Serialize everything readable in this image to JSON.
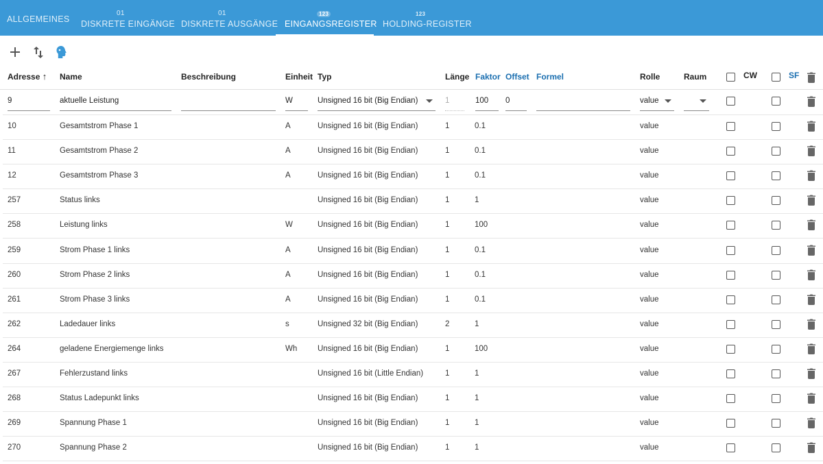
{
  "tabs": [
    {
      "label": "ALLGEMEINES",
      "icon_text": ""
    },
    {
      "label": "DISKRETE EINGÄNGE",
      "icon_text": "01"
    },
    {
      "label": "DISKRETE AUSGÄNGE",
      "icon_text": "01"
    },
    {
      "label": "EINGANGSREGISTER",
      "icon_text": "123",
      "active": true
    },
    {
      "label": "HOLDING-REGISTER",
      "icon_text": "123"
    }
  ],
  "toolbar": {
    "add_icon": "plus-icon",
    "sort_icon": "swap-vertical-icon",
    "import_icon": "head-icon"
  },
  "columns": {
    "address": "Adresse",
    "name": "Name",
    "description": "Beschreibung",
    "unit": "Einheit",
    "type": "Typ",
    "length": "Länge",
    "factor": "Faktor",
    "offset": "Offset",
    "formula": "Formel",
    "role": "Rolle",
    "room": "Raum",
    "cw": "CW",
    "sf": "SF"
  },
  "edit_row": {
    "address": "9",
    "name": "aktuelle Leistung",
    "description": "",
    "unit": "W",
    "type": "Unsigned 16 bit (Big Endian)",
    "length": "1",
    "factor": "100",
    "offset": "0",
    "formula": "",
    "role": "value",
    "room": ""
  },
  "rows": [
    {
      "address": "10",
      "name": "Gesamtstrom Phase 1",
      "unit": "A",
      "type": "Unsigned 16 bit (Big Endian)",
      "length": "1",
      "factor": "0.1",
      "role": "value"
    },
    {
      "address": "11",
      "name": "Gesamtstrom Phase 2",
      "unit": "A",
      "type": "Unsigned 16 bit (Big Endian)",
      "length": "1",
      "factor": "0.1",
      "role": "value"
    },
    {
      "address": "12",
      "name": "Gesamtstrom Phase 3",
      "unit": "A",
      "type": "Unsigned 16 bit (Big Endian)",
      "length": "1",
      "factor": "0.1",
      "role": "value"
    },
    {
      "address": "257",
      "name": "Status links",
      "unit": "",
      "type": "Unsigned 16 bit (Big Endian)",
      "length": "1",
      "factor": "1",
      "role": "value"
    },
    {
      "address": "258",
      "name": "Leistung links",
      "unit": "W",
      "type": "Unsigned 16 bit (Big Endian)",
      "length": "1",
      "factor": "100",
      "role": "value"
    },
    {
      "address": "259",
      "name": "Strom Phase 1 links",
      "unit": "A",
      "type": "Unsigned 16 bit (Big Endian)",
      "length": "1",
      "factor": "0.1",
      "role": "value"
    },
    {
      "address": "260",
      "name": "Strom Phase 2 links",
      "unit": "A",
      "type": "Unsigned 16 bit (Big Endian)",
      "length": "1",
      "factor": "0.1",
      "role": "value"
    },
    {
      "address": "261",
      "name": "Strom Phase 3 links",
      "unit": "A",
      "type": "Unsigned 16 bit (Big Endian)",
      "length": "1",
      "factor": "0.1",
      "role": "value"
    },
    {
      "address": "262",
      "name": "Ladedauer links",
      "unit": "s",
      "type": "Unsigned 32 bit (Big Endian)",
      "length": "2",
      "factor": "1",
      "role": "value"
    },
    {
      "address": "264",
      "name": "geladene Energiemenge links",
      "unit": "Wh",
      "type": "Unsigned 16 bit (Big Endian)",
      "length": "1",
      "factor": "100",
      "role": "value"
    },
    {
      "address": "267",
      "name": "Fehlerzustand links",
      "unit": "",
      "type": "Unsigned 16 bit (Little Endian)",
      "length": "1",
      "factor": "1",
      "role": "value"
    },
    {
      "address": "268",
      "name": "Status Ladepunkt links",
      "unit": "",
      "type": "Unsigned 16 bit (Big Endian)",
      "length": "1",
      "factor": "1",
      "role": "value"
    },
    {
      "address": "269",
      "name": "Spannung Phase 1",
      "unit": "",
      "type": "Unsigned 16 bit (Big Endian)",
      "length": "1",
      "factor": "1",
      "role": "value"
    },
    {
      "address": "270",
      "name": "Spannung Phase 2",
      "unit": "",
      "type": "Unsigned 16 bit (Big Endian)",
      "length": "1",
      "factor": "1",
      "role": "value"
    }
  ],
  "colors": {
    "tabbar": "#3b99d7",
    "accent_header": "#1b6fb0"
  }
}
